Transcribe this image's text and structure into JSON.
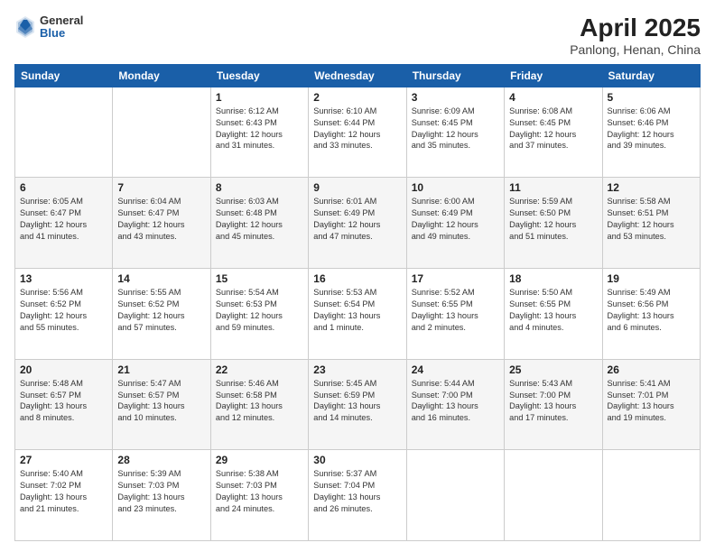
{
  "header": {
    "logo": {
      "general": "General",
      "blue": "Blue"
    },
    "title": "April 2025",
    "subtitle": "Panlong, Henan, China"
  },
  "calendar": {
    "days_of_week": [
      "Sunday",
      "Monday",
      "Tuesday",
      "Wednesday",
      "Thursday",
      "Friday",
      "Saturday"
    ],
    "weeks": [
      [
        {
          "day": "",
          "info": ""
        },
        {
          "day": "",
          "info": ""
        },
        {
          "day": "1",
          "info": "Sunrise: 6:12 AM\nSunset: 6:43 PM\nDaylight: 12 hours\nand 31 minutes."
        },
        {
          "day": "2",
          "info": "Sunrise: 6:10 AM\nSunset: 6:44 PM\nDaylight: 12 hours\nand 33 minutes."
        },
        {
          "day": "3",
          "info": "Sunrise: 6:09 AM\nSunset: 6:45 PM\nDaylight: 12 hours\nand 35 minutes."
        },
        {
          "day": "4",
          "info": "Sunrise: 6:08 AM\nSunset: 6:45 PM\nDaylight: 12 hours\nand 37 minutes."
        },
        {
          "day": "5",
          "info": "Sunrise: 6:06 AM\nSunset: 6:46 PM\nDaylight: 12 hours\nand 39 minutes."
        }
      ],
      [
        {
          "day": "6",
          "info": "Sunrise: 6:05 AM\nSunset: 6:47 PM\nDaylight: 12 hours\nand 41 minutes."
        },
        {
          "day": "7",
          "info": "Sunrise: 6:04 AM\nSunset: 6:47 PM\nDaylight: 12 hours\nand 43 minutes."
        },
        {
          "day": "8",
          "info": "Sunrise: 6:03 AM\nSunset: 6:48 PM\nDaylight: 12 hours\nand 45 minutes."
        },
        {
          "day": "9",
          "info": "Sunrise: 6:01 AM\nSunset: 6:49 PM\nDaylight: 12 hours\nand 47 minutes."
        },
        {
          "day": "10",
          "info": "Sunrise: 6:00 AM\nSunset: 6:49 PM\nDaylight: 12 hours\nand 49 minutes."
        },
        {
          "day": "11",
          "info": "Sunrise: 5:59 AM\nSunset: 6:50 PM\nDaylight: 12 hours\nand 51 minutes."
        },
        {
          "day": "12",
          "info": "Sunrise: 5:58 AM\nSunset: 6:51 PM\nDaylight: 12 hours\nand 53 minutes."
        }
      ],
      [
        {
          "day": "13",
          "info": "Sunrise: 5:56 AM\nSunset: 6:52 PM\nDaylight: 12 hours\nand 55 minutes."
        },
        {
          "day": "14",
          "info": "Sunrise: 5:55 AM\nSunset: 6:52 PM\nDaylight: 12 hours\nand 57 minutes."
        },
        {
          "day": "15",
          "info": "Sunrise: 5:54 AM\nSunset: 6:53 PM\nDaylight: 12 hours\nand 59 minutes."
        },
        {
          "day": "16",
          "info": "Sunrise: 5:53 AM\nSunset: 6:54 PM\nDaylight: 13 hours\nand 1 minute."
        },
        {
          "day": "17",
          "info": "Sunrise: 5:52 AM\nSunset: 6:55 PM\nDaylight: 13 hours\nand 2 minutes."
        },
        {
          "day": "18",
          "info": "Sunrise: 5:50 AM\nSunset: 6:55 PM\nDaylight: 13 hours\nand 4 minutes."
        },
        {
          "day": "19",
          "info": "Sunrise: 5:49 AM\nSunset: 6:56 PM\nDaylight: 13 hours\nand 6 minutes."
        }
      ],
      [
        {
          "day": "20",
          "info": "Sunrise: 5:48 AM\nSunset: 6:57 PM\nDaylight: 13 hours\nand 8 minutes."
        },
        {
          "day": "21",
          "info": "Sunrise: 5:47 AM\nSunset: 6:57 PM\nDaylight: 13 hours\nand 10 minutes."
        },
        {
          "day": "22",
          "info": "Sunrise: 5:46 AM\nSunset: 6:58 PM\nDaylight: 13 hours\nand 12 minutes."
        },
        {
          "day": "23",
          "info": "Sunrise: 5:45 AM\nSunset: 6:59 PM\nDaylight: 13 hours\nand 14 minutes."
        },
        {
          "day": "24",
          "info": "Sunrise: 5:44 AM\nSunset: 7:00 PM\nDaylight: 13 hours\nand 16 minutes."
        },
        {
          "day": "25",
          "info": "Sunrise: 5:43 AM\nSunset: 7:00 PM\nDaylight: 13 hours\nand 17 minutes."
        },
        {
          "day": "26",
          "info": "Sunrise: 5:41 AM\nSunset: 7:01 PM\nDaylight: 13 hours\nand 19 minutes."
        }
      ],
      [
        {
          "day": "27",
          "info": "Sunrise: 5:40 AM\nSunset: 7:02 PM\nDaylight: 13 hours\nand 21 minutes."
        },
        {
          "day": "28",
          "info": "Sunrise: 5:39 AM\nSunset: 7:03 PM\nDaylight: 13 hours\nand 23 minutes."
        },
        {
          "day": "29",
          "info": "Sunrise: 5:38 AM\nSunset: 7:03 PM\nDaylight: 13 hours\nand 24 minutes."
        },
        {
          "day": "30",
          "info": "Sunrise: 5:37 AM\nSunset: 7:04 PM\nDaylight: 13 hours\nand 26 minutes."
        },
        {
          "day": "",
          "info": ""
        },
        {
          "day": "",
          "info": ""
        },
        {
          "day": "",
          "info": ""
        }
      ]
    ]
  }
}
